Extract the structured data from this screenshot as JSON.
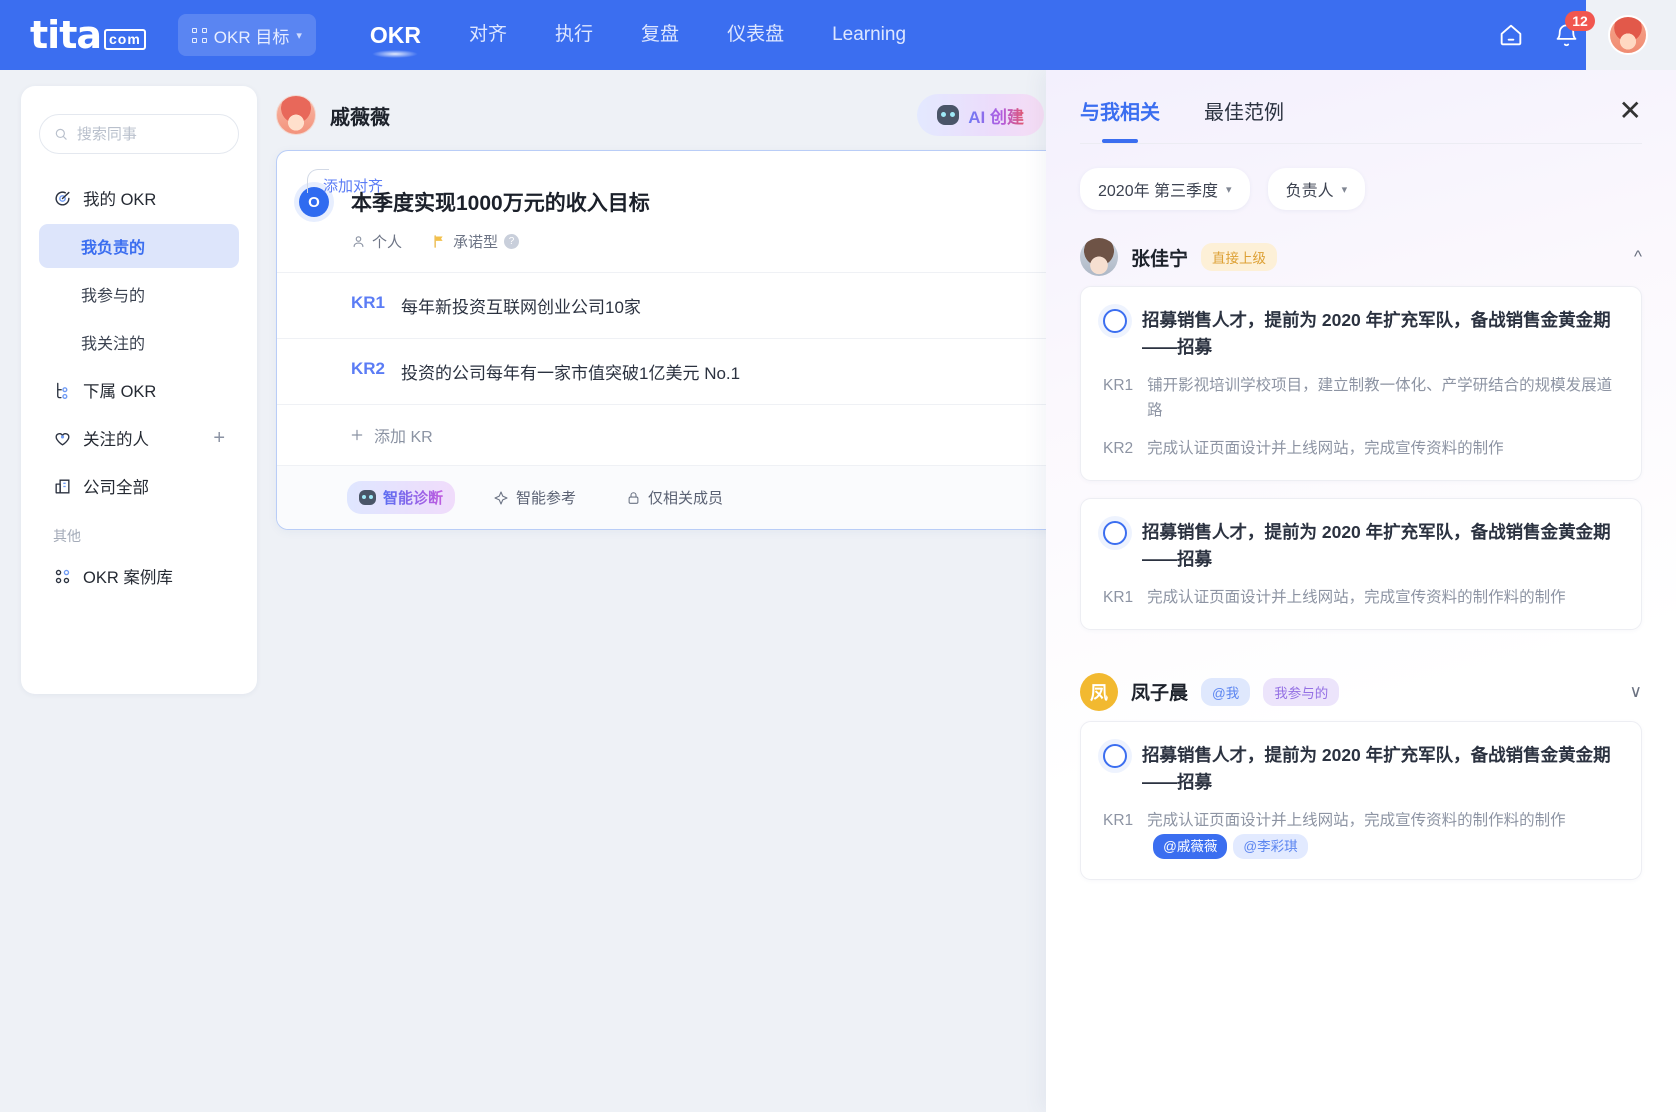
{
  "header": {
    "logo_main": "tita",
    "logo_suffix": ".com",
    "product_switcher": "OKR 目标",
    "nav": [
      {
        "label": "OKR",
        "active": true
      },
      {
        "label": "对齐",
        "active": false
      },
      {
        "label": "执行",
        "active": false
      },
      {
        "label": "复盘",
        "active": false
      },
      {
        "label": "仪表盘",
        "active": false
      },
      {
        "label": "Learning",
        "active": false
      }
    ],
    "home_icon": "home-icon",
    "bell_icon": "bell-icon",
    "notification_count": "12",
    "avatar_icon": "user-avatar"
  },
  "sidebar": {
    "search_placeholder": "搜索同事",
    "search_value": "",
    "items": [
      {
        "label": "我的 OKR",
        "icon": "target-icon",
        "level": "top",
        "active": false
      },
      {
        "label": "我负责的",
        "icon": "",
        "level": "sub",
        "active": true
      },
      {
        "label": "我参与的",
        "icon": "",
        "level": "sub",
        "active": false
      },
      {
        "label": "我关注的",
        "icon": "",
        "level": "sub",
        "active": false
      },
      {
        "label": "下属 OKR",
        "icon": "org-tree-icon",
        "level": "top",
        "active": false
      },
      {
        "label": "关注的人",
        "icon": "heart-icon",
        "level": "top",
        "active": false,
        "action": "+"
      },
      {
        "label": "公司全部",
        "icon": "building-icon",
        "level": "top",
        "active": false
      }
    ],
    "section_other": "其他",
    "other_items": [
      {
        "label": "OKR 案例库",
        "icon": "grid-dots-icon"
      }
    ]
  },
  "main": {
    "owner_name": "戚薇薇",
    "ai_create_label": "AI 创建",
    "ai_create_prefix": "AI ",
    "ai_create_suffix": "创建",
    "card": {
      "add_align_label": "添加对齐",
      "objective_badge": "O",
      "objective_title": "本季度实现1000万元的收入目标",
      "meta": [
        {
          "label": "个人",
          "icon": "person-icon"
        },
        {
          "label": "承诺型",
          "icon": "flag-icon",
          "help": "?"
        }
      ],
      "key_results": [
        {
          "tag": "KR1",
          "text": "每年新投资互联网创业公司10家"
        },
        {
          "tag": "KR2",
          "text": "投资的公司每年有一家市值突破1亿美元 No.1"
        }
      ],
      "add_kr_label": "添加 KR",
      "footer_actions": [
        {
          "label": "智能诊断",
          "icon": "robot-icon",
          "style": "gradient"
        },
        {
          "label": "智能参考",
          "icon": "sparkle-icon",
          "style": "plain"
        },
        {
          "label": "仅相关成员",
          "icon": "lock-icon",
          "style": "plain"
        }
      ]
    }
  },
  "right_panel": {
    "tabs": [
      {
        "label": "与我相关",
        "active": true
      },
      {
        "label": "最佳范例",
        "active": false
      }
    ],
    "close_icon": "close-icon",
    "filters": [
      {
        "label": "2020年 第三季度",
        "icon": "chevron-down-icon"
      },
      {
        "label": "负责人",
        "icon": "chevron-down-icon"
      }
    ],
    "groups": [
      {
        "person": "张佳宁",
        "avatar_type": "photo",
        "avatar_letter": "",
        "tags": [
          {
            "text": "直接上级",
            "color": "orange"
          }
        ],
        "expanded": true,
        "toggle_icon": "chevron-up-icon",
        "cards": [
          {
            "badge": "O",
            "title": "招募销售人才，提前为 2020 年扩充军队，备战销售金黄金期——招募",
            "key_results": [
              {
                "tag": "KR1",
                "text": "铺开影视培训学校项目，建立制教一体化、产学研结合的规模发展道路",
                "mentions": []
              },
              {
                "tag": "KR2",
                "text": "完成认证页面设计并上线网站，完成宣传资料的制作",
                "mentions": []
              }
            ]
          },
          {
            "badge": "O",
            "title": "招募销售人才，提前为 2020 年扩充军队，备战销售金黄金期——招募",
            "key_results": [
              {
                "tag": "KR1",
                "text": "完成认证页面设计并上线网站，完成宣传资料的制作料的制作",
                "mentions": []
              }
            ]
          }
        ]
      },
      {
        "person": "凤子晨",
        "avatar_type": "letter",
        "avatar_letter": "凤",
        "tags": [
          {
            "text": "@我",
            "color": "blue"
          },
          {
            "text": "我参与的",
            "color": "purple"
          }
        ],
        "expanded": false,
        "toggle_icon": "chevron-down-icon",
        "cards": [
          {
            "badge": "O",
            "title": "招募销售人才，提前为 2020 年扩充军队，备战销售金黄金期——招募",
            "key_results": [
              {
                "tag": "KR1",
                "text": "完成认证页面设计并上线网站，完成宣传资料的制作料的制作",
                "mentions": [
                  {
                    "text": "@戚薇薇",
                    "style": "solid"
                  },
                  {
                    "text": "@李彩琪",
                    "style": "soft"
                  }
                ]
              }
            ]
          }
        ]
      }
    ]
  },
  "colors": {
    "brand_blue": "#3b6ef0",
    "badge_red": "#f1564f",
    "active_bg": "#dde5fb",
    "tag_orange": "#dda034"
  }
}
